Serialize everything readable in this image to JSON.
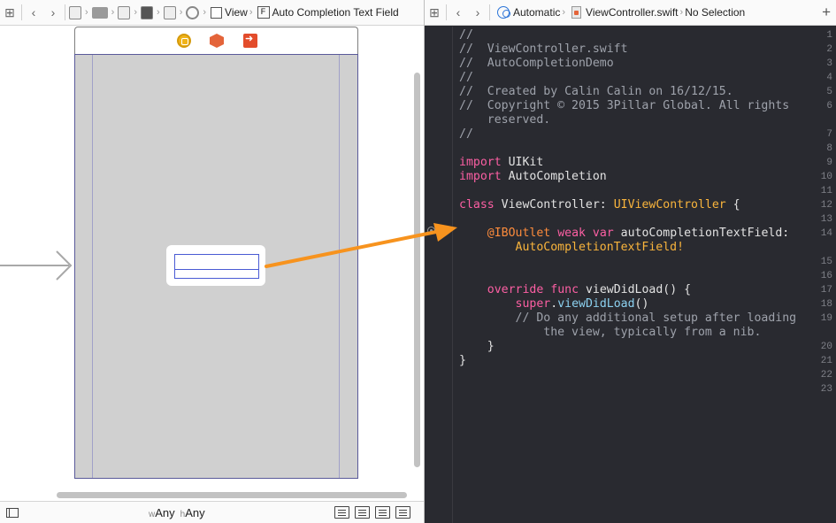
{
  "left_jumpbar": {
    "crumbs": [
      "View",
      "Auto Completion Text Field"
    ]
  },
  "right_jumpbar": {
    "mode": "Automatic",
    "file": "ViewController.swift",
    "selection": "No Selection"
  },
  "bottombar": {
    "width_prefix": "w",
    "width_value": "Any",
    "height_prefix": "h",
    "height_value": "Any"
  },
  "editor": {
    "line_numbers": [
      "1",
      "2",
      "3",
      "4",
      "5",
      "6",
      "",
      "7",
      "8",
      "9",
      "10",
      "11",
      "12",
      "13",
      "14",
      "",
      "15",
      "16",
      "17",
      "18",
      "19",
      "",
      "20",
      "21",
      "22",
      "23"
    ],
    "lines": [
      [
        {
          "t": "//",
          "c": "comment"
        }
      ],
      [
        {
          "t": "//  ViewController.swift",
          "c": "comment"
        }
      ],
      [
        {
          "t": "//  AutoCompletionDemo",
          "c": "comment"
        }
      ],
      [
        {
          "t": "//",
          "c": "comment"
        }
      ],
      [
        {
          "t": "//  Created by Calin Calin on 16/12/15.",
          "c": "comment"
        }
      ],
      [
        {
          "t": "//  Copyright © 2015 3Pillar Global. All rights",
          "c": "comment"
        }
      ],
      [
        {
          "t": "    reserved.",
          "c": "comment"
        }
      ],
      [
        {
          "t": "//",
          "c": "comment"
        }
      ],
      [
        {
          "t": "",
          "c": "plain"
        }
      ],
      [
        {
          "t": "import",
          "c": "kw"
        },
        {
          "t": " UIKit",
          "c": "plain"
        }
      ],
      [
        {
          "t": "import",
          "c": "kw"
        },
        {
          "t": " AutoCompletion",
          "c": "plain"
        }
      ],
      [
        {
          "t": "",
          "c": "plain"
        }
      ],
      [
        {
          "t": "class",
          "c": "kw"
        },
        {
          "t": " ViewController: ",
          "c": "plain"
        },
        {
          "t": "UIViewController",
          "c": "type"
        },
        {
          "t": " {",
          "c": "plain"
        }
      ],
      [
        {
          "t": "",
          "c": "plain"
        }
      ],
      [
        {
          "t": "    ",
          "c": "plain"
        },
        {
          "t": "@IBOutlet",
          "c": "attr"
        },
        {
          "t": " ",
          "c": "plain"
        },
        {
          "t": "weak",
          "c": "kw"
        },
        {
          "t": " ",
          "c": "plain"
        },
        {
          "t": "var",
          "c": "kw"
        },
        {
          "t": " autoCompletionTextField:",
          "c": "plain"
        }
      ],
      [
        {
          "t": "        AutoCompletionTextField!",
          "c": "type"
        }
      ],
      [
        {
          "t": "",
          "c": "plain"
        }
      ],
      [
        {
          "t": "",
          "c": "plain"
        }
      ],
      [
        {
          "t": "    ",
          "c": "plain"
        },
        {
          "t": "override",
          "c": "kw"
        },
        {
          "t": " ",
          "c": "plain"
        },
        {
          "t": "func",
          "c": "kw"
        },
        {
          "t": " viewDidLoad() {",
          "c": "plain"
        }
      ],
      [
        {
          "t": "        ",
          "c": "plain"
        },
        {
          "t": "super",
          "c": "kw"
        },
        {
          "t": ".",
          "c": "plain"
        },
        {
          "t": "viewDidLoad",
          "c": "call"
        },
        {
          "t": "()",
          "c": "plain"
        }
      ],
      [
        {
          "t": "        // Do any additional setup after loading",
          "c": "comment"
        }
      ],
      [
        {
          "t": "            the view, typically from a nib.",
          "c": "comment"
        }
      ],
      [
        {
          "t": "    }",
          "c": "plain"
        }
      ],
      [
        {
          "t": "}",
          "c": "plain"
        }
      ],
      [
        {
          "t": "",
          "c": "plain"
        }
      ],
      [
        {
          "t": "",
          "c": "plain"
        }
      ]
    ]
  },
  "colors": {
    "connection_arrow": "#f7931e",
    "editor_bg": "#292a30",
    "ib_canvas": "#d0d0d0"
  }
}
